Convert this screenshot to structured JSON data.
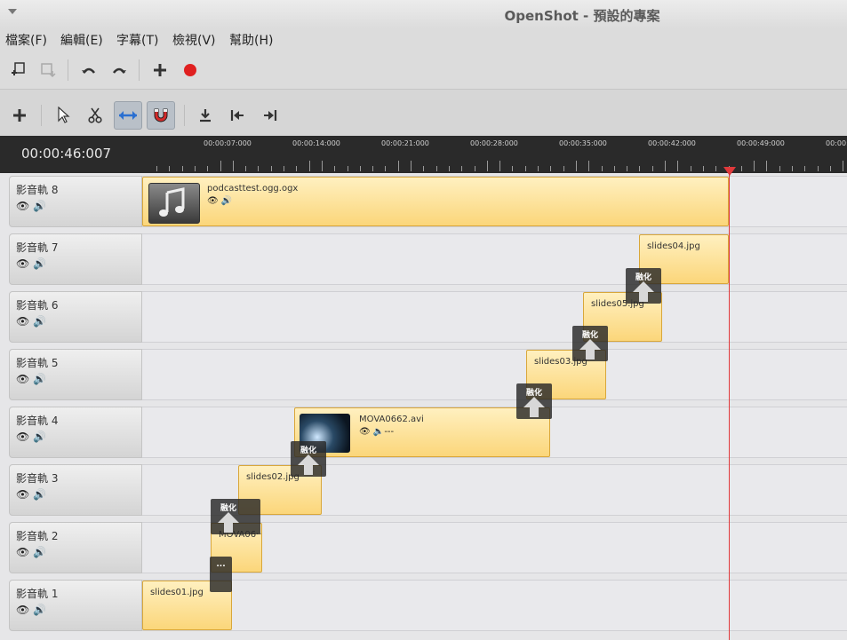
{
  "window": {
    "title": "OpenShot - 預設的專案"
  },
  "menu": [
    "檔案(F)",
    "編輯(E)",
    "字幕(T)",
    "檢視(V)",
    "幫助(H)"
  ],
  "toolbar": {
    "icons": [
      "import-files-icon",
      "export-icon",
      "undo-icon",
      "redo-icon",
      "add-track-icon",
      "record-icon"
    ]
  },
  "timeline_toolbar": {
    "icons": [
      "add-track-icon",
      "select-tool-icon",
      "razor-tool-icon",
      "resize-tool-icon",
      "snapping-magnet-icon",
      "add-marker-icon",
      "previous-marker-icon",
      "next-marker-icon"
    ]
  },
  "ruler": {
    "timecode": "00:00:46:007",
    "labels": [
      "00:00:07:000",
      "00:00:14:000",
      "00:00:21:000",
      "00:00:28:000",
      "00:00:35:000",
      "00:00:42:000",
      "00:00:49:000",
      "00:00:"
    ]
  },
  "tracks": [
    {
      "name": "影音軌 8"
    },
    {
      "name": "影音軌 7"
    },
    {
      "name": "影音軌 6"
    },
    {
      "name": "影音軌 5"
    },
    {
      "name": "影音軌 4"
    },
    {
      "name": "影音軌 3"
    },
    {
      "name": "影音軌 2"
    },
    {
      "name": "影音軌 1"
    }
  ],
  "clips": {
    "c8": "podcasttest.ogg.ogx",
    "c7": "slides04.jpg",
    "c6": "slides05.jpg",
    "c5": "slides03.jpg",
    "c4": "MOVA0662.avi",
    "c4_audio": "---",
    "c3": "slides02.jpg",
    "c2": "MOVA06··",
    "c1": "slides01.jpg"
  },
  "transitions": {
    "fade": "融化",
    "short": "..."
  },
  "colors": {
    "clip": "#fbd67a",
    "playhead": "#e0393b",
    "ruler_bg": "#2a2a2a"
  }
}
